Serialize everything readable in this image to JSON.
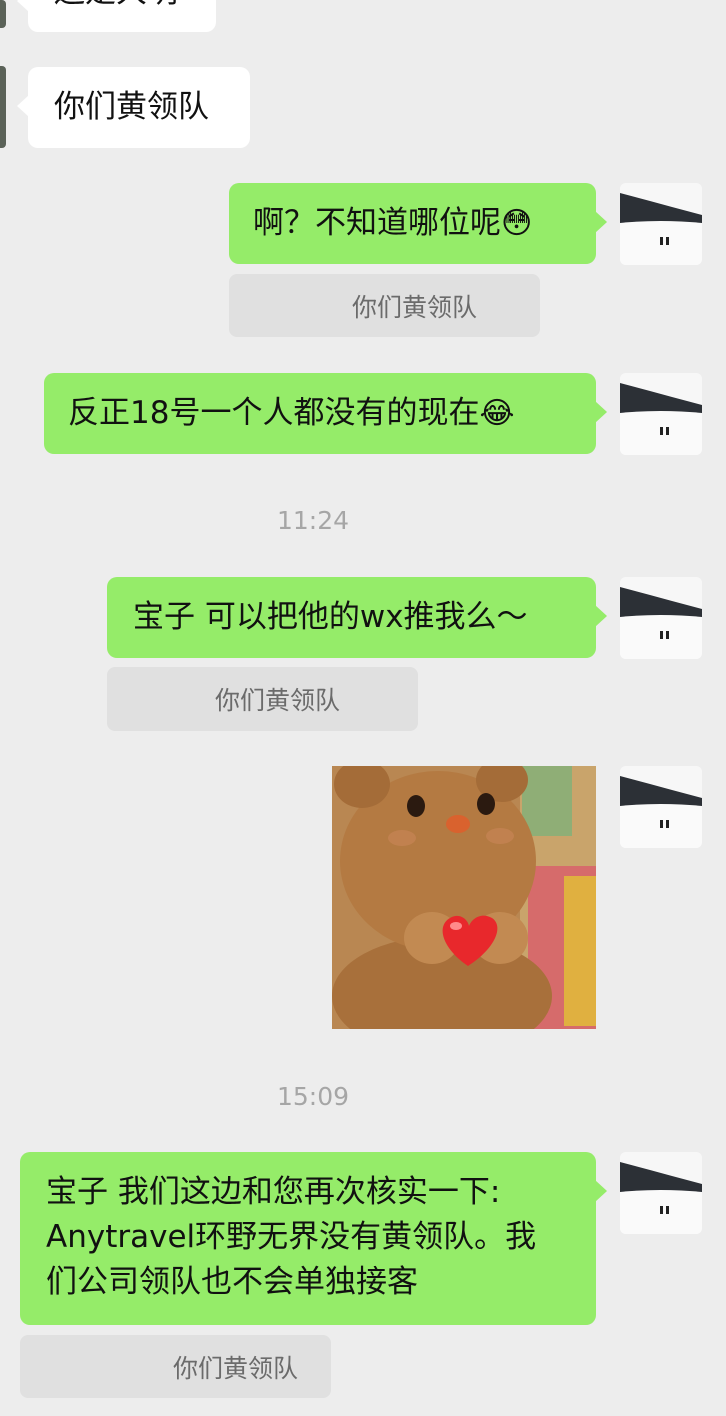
{
  "messages": {
    "in_top_partial": "还是大明",
    "in_1": "你们黄领队",
    "out_1": {
      "text": "啊？不知道哪位呢",
      "emoji": "😳"
    },
    "quote_1": "你们黄领队",
    "out_2": {
      "text": "反正18号一个人都没有的现在",
      "emoji": "😂"
    },
    "time_1": "11:24",
    "out_3": "宝子 可以把他的wx推我么～",
    "quote_2": "你们黄领队",
    "time_2": "15:09",
    "out_4": {
      "line1": "宝子 我们这边和您再次核实一下:",
      "line2": "Anytravel环野无界没有黄领队。我",
      "line3": "们公司领队也不会单独接客"
    },
    "quote_3": "你们黄领队"
  },
  "icons": {
    "avatar": "snow-landscape-avatar",
    "sticker": "bear-heart-sticker"
  },
  "colors": {
    "background": "#ededed",
    "outgoing_bubble": "#95ec69",
    "incoming_bubble": "#ffffff",
    "quote_box": "#e0e0e0",
    "timestamp": "#a6a6a6"
  }
}
